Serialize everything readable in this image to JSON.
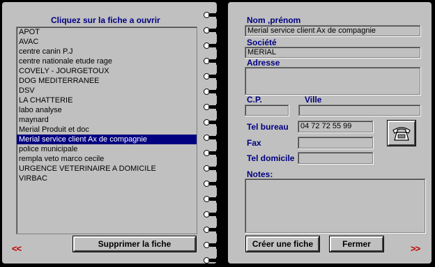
{
  "left_page": {
    "title": "Cliquez sur la fiche a ouvrir",
    "list": [
      "APOT",
      "AVAC",
      "centre canin P.J",
      "centre nationale etude rage",
      "COVELY - JOURGETOUX",
      "DOG MEDITERRANEE",
      "DSV",
      "LA CHATTERIE",
      "labo analyse",
      "maynard",
      "Merial Produit et doc",
      "Merial service client Ax de compagnie",
      "police municipale",
      "rempla veto marco cecile",
      "URGENCE VETERINAIRE A DOMICILE",
      "VIRBAC"
    ],
    "selected_item": "Merial service client Ax de compagnie",
    "delete_button": "Supprimer la fiche",
    "prev_arrow": "<<"
  },
  "right_page": {
    "name_label": "Nom ,prénom",
    "name_value": "Merial service client Ax de compagnie",
    "company_label": "Société",
    "company_value": "MERIAL",
    "address_label": "Adresse",
    "address_value": "",
    "cp_label": "C.P.",
    "cp_value": "",
    "city_label": "Ville",
    "city_value": "",
    "tel_office_label": "Tel bureau",
    "tel_office_value": "04 72 72 55 99",
    "fax_label": "Fax",
    "fax_value": "",
    "tel_home_label": "Tel domicile",
    "tel_home_value": "",
    "notes_label": "Notes:",
    "notes_value": "",
    "create_button": "Créer une fiche",
    "close_button": "Fermer",
    "next_arrow": ">>",
    "dial_icon": "telephone-icon"
  },
  "colors": {
    "label_blue": "#000080",
    "selection": "#000080",
    "arrow_red": "#c00000",
    "panel_gray": "#c0c0c0"
  }
}
